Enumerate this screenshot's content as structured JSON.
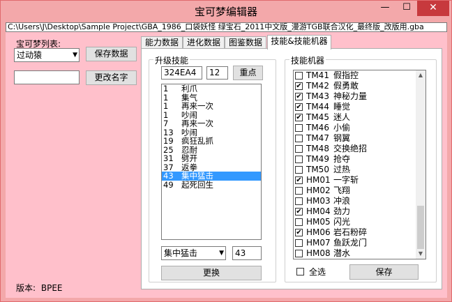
{
  "window": {
    "title": "宝可梦编辑器",
    "min_glyph": "—",
    "max_glyph": "☐",
    "close_glyph": "✕"
  },
  "file_path": "C:\\Users\\J\\Desktop\\Sample Project\\GBA_1986_口袋妖怪 绿宝石_2011中文版_漫游TGB联合汉化_最终版_改版用.gba",
  "left_panel": {
    "pokemon_list_label": "宝可梦列表:",
    "selected_pokemon": "过动猿",
    "save_button": "保存数据",
    "name_input_value": "",
    "rename_button": "更改名字",
    "version_label": "版本:",
    "version_value": "BPEE"
  },
  "tabs": [
    {
      "label": "能力数据",
      "active": false
    },
    {
      "label": "进化数据",
      "active": false
    },
    {
      "label": "图鉴数据",
      "active": false
    },
    {
      "label": "技能&技能机器",
      "active": true
    }
  ],
  "level_moves": {
    "group_title": "升级技能",
    "offset_value": "324EA4",
    "count_value": "12",
    "focus_button": "重点",
    "moves": [
      {
        "level": "1",
        "name": "利爪"
      },
      {
        "level": "1",
        "name": "集气"
      },
      {
        "level": "1",
        "name": "再来一次"
      },
      {
        "level": "1",
        "name": "吵闹"
      },
      {
        "level": "7",
        "name": "再来一次"
      },
      {
        "level": "13",
        "name": "吵闹"
      },
      {
        "level": "19",
        "name": "疯狂乱抓"
      },
      {
        "level": "25",
        "name": "忍耐"
      },
      {
        "level": "31",
        "name": "劈开"
      },
      {
        "level": "37",
        "name": "返拳"
      },
      {
        "level": "43",
        "name": "集中猛击"
      },
      {
        "level": "49",
        "name": "起死回生"
      }
    ],
    "selected_index": 10,
    "selected_move": "集中猛击",
    "selected_level": "43",
    "replace_button": "更换"
  },
  "tm_moves": {
    "group_title": "技能机器",
    "items": [
      {
        "code": "TM41",
        "name": "假指控",
        "checked": false
      },
      {
        "code": "TM42",
        "name": "假勇敢",
        "checked": true
      },
      {
        "code": "TM43",
        "name": "神秘力量",
        "checked": true
      },
      {
        "code": "TM44",
        "name": "睡觉",
        "checked": true
      },
      {
        "code": "TM45",
        "name": "迷人",
        "checked": true
      },
      {
        "code": "TM46",
        "name": "小偷",
        "checked": false
      },
      {
        "code": "TM47",
        "name": "钢翼",
        "checked": false
      },
      {
        "code": "TM48",
        "name": "交换绝招",
        "checked": false
      },
      {
        "code": "TM49",
        "name": "抢夺",
        "checked": false
      },
      {
        "code": "TM50",
        "name": "过热",
        "checked": false
      },
      {
        "code": "HM01",
        "name": "一字斩",
        "checked": true
      },
      {
        "code": "HM02",
        "name": "飞翔",
        "checked": false
      },
      {
        "code": "HM03",
        "name": "冲浪",
        "checked": false
      },
      {
        "code": "HM04",
        "name": "劲力",
        "checked": true
      },
      {
        "code": "HM05",
        "name": "闪光",
        "checked": false
      },
      {
        "code": "HM06",
        "name": "岩石粉碎",
        "checked": true
      },
      {
        "code": "HM07",
        "name": "鱼跃龙门",
        "checked": false
      },
      {
        "code": "HM08",
        "name": "潜水",
        "checked": false
      }
    ],
    "select_all_label": "全选",
    "select_all_checked": false,
    "save_button": "保存"
  },
  "glyphs": {
    "dropdown": "▼",
    "scroll_up": "▲",
    "scroll_down": "▼",
    "check": "✔"
  },
  "colors": {
    "title_background": "#f3a8aa",
    "client_background": "#ffc0cb",
    "close_button": "#c7393d",
    "selection": "#3399ff"
  }
}
